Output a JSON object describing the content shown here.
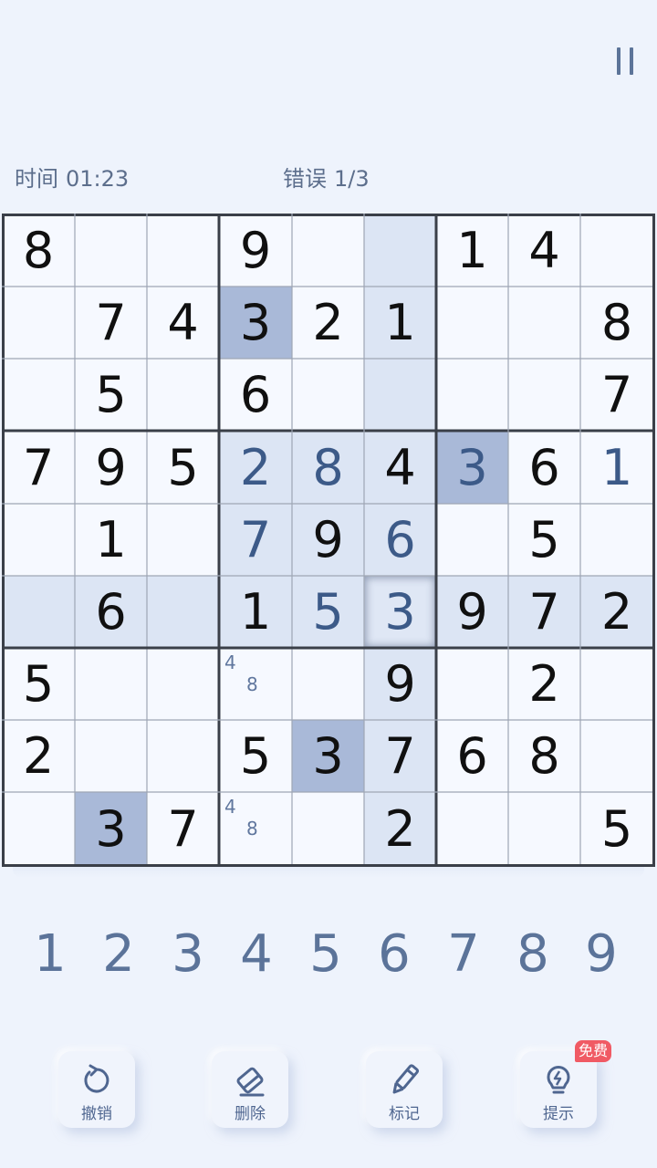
{
  "header": {
    "pause_icon": "pause-icon"
  },
  "status": {
    "time_label": "时间",
    "time_value": "01:23",
    "errors_label": "错误",
    "errors_value": "1/3"
  },
  "board": {
    "grid": [
      [
        "8",
        "",
        "",
        "9",
        "",
        "",
        "1",
        "4",
        ""
      ],
      [
        "",
        "7",
        "4",
        "3",
        "2",
        "1",
        "",
        "",
        "8"
      ],
      [
        "",
        "5",
        "",
        "6",
        "",
        "",
        "",
        "",
        "7"
      ],
      [
        "7",
        "9",
        "5",
        "2",
        "8",
        "4",
        "3",
        "6",
        "1"
      ],
      [
        "",
        "1",
        "",
        "7",
        "9",
        "6",
        "",
        "5",
        ""
      ],
      [
        "",
        "6",
        "",
        "1",
        "5",
        "3",
        "9",
        "7",
        "2"
      ],
      [
        "5",
        "",
        "",
        "",
        "",
        "9",
        "",
        "2",
        ""
      ],
      [
        "2",
        "",
        "",
        "5",
        "3",
        "7",
        "6",
        "8",
        ""
      ],
      [
        "",
        "3",
        "7",
        "",
        "",
        "2",
        "",
        "",
        "5"
      ]
    ],
    "user_entries": [
      [
        3,
        3
      ],
      [
        3,
        4
      ],
      [
        3,
        6
      ],
      [
        3,
        8
      ],
      [
        4,
        3
      ],
      [
        4,
        5
      ],
      [
        5,
        4
      ],
      [
        5,
        5
      ]
    ],
    "notes": [
      {
        "row": 6,
        "col": 3,
        "values": [
          "4",
          "8"
        ]
      },
      {
        "row": 8,
        "col": 3,
        "values": [
          "4",
          "8"
        ]
      }
    ],
    "selected": [
      5,
      5
    ],
    "same_value_cells": [
      [
        1,
        3
      ],
      [
        3,
        6
      ],
      [
        7,
        4
      ],
      [
        8,
        1
      ]
    ],
    "highlight_color": "#dce5f4",
    "same_value_color": "#a9b9d8",
    "given_color": "#101010",
    "entered_color": "#3c5a88"
  },
  "numpad": [
    "1",
    "2",
    "3",
    "4",
    "5",
    "6",
    "7",
    "8",
    "9"
  ],
  "toolbar": {
    "undo": {
      "label": "撤销",
      "icon": "undo-icon"
    },
    "erase": {
      "label": "删除",
      "icon": "eraser-icon"
    },
    "notes": {
      "label": "标记",
      "icon": "pencil-icon"
    },
    "hint": {
      "label": "提示",
      "icon": "lightbulb-icon",
      "badge": "免费"
    }
  }
}
